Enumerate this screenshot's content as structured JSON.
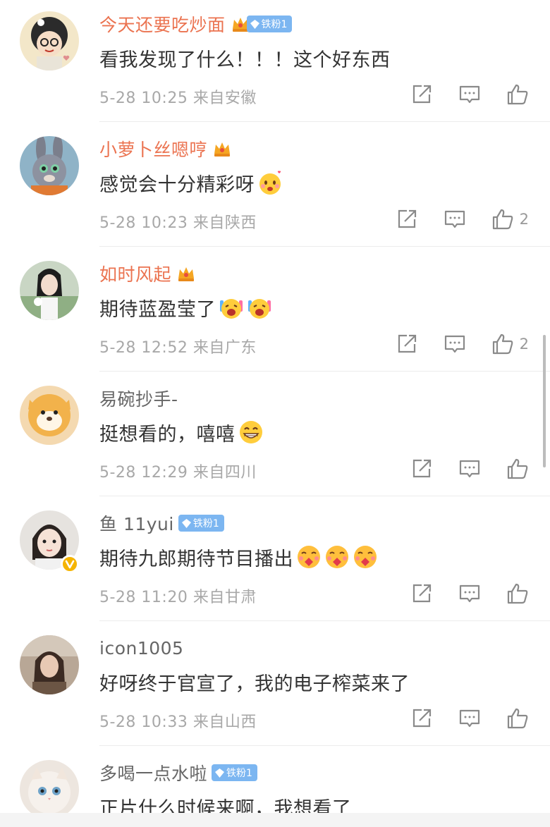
{
  "colors": {
    "vip_name": "#eb7350",
    "plain_name": "#666666",
    "text": "#333333",
    "meta": "#a8a8a8",
    "fan_badge": "#7cb6f1"
  },
  "comments": [
    {
      "name": "今天还要吃炒面",
      "vip": true,
      "crown": "crown-icon",
      "fan_badge": "铁粉1",
      "text": "看我发现了什么！！！这个好东西",
      "emoji": [],
      "time": "5-28 10:25",
      "location": "来自安徽",
      "likes": ""
    },
    {
      "name": "小萝卜丝嗯哼",
      "vip": true,
      "crown": "crown-icon",
      "fan_badge": "",
      "text": "感觉会十分精彩呀",
      "emoji": [
        "love-face-emoji"
      ],
      "time": "5-28 10:23",
      "location": "来自陕西",
      "likes": "2"
    },
    {
      "name": "如时风起",
      "vip": true,
      "crown": "crown-icon",
      "fan_badge": "",
      "text": "期待蓝盈莹了",
      "emoji": [
        "excited-face-emoji",
        "excited-face-emoji"
      ],
      "time": "5-28 12:52",
      "location": "来自广东",
      "likes": "2"
    },
    {
      "name": "易碗抄手-",
      "vip": false,
      "crown": "",
      "fan_badge": "",
      "text": "挺想看的，嘻嘻",
      "emoji": [
        "grin-emoji"
      ],
      "time": "5-28 12:29",
      "location": "来自四川",
      "likes": ""
    },
    {
      "name": "鱼 11yui",
      "vip": false,
      "crown": "",
      "fan_badge": "铁粉1",
      "text": "期待九郎期待节目播出",
      "emoji": [
        "kiss-face-emoji",
        "kiss-face-emoji",
        "kiss-face-emoji"
      ],
      "time": "5-28 11:20",
      "location": "来自甘肃",
      "likes": ""
    },
    {
      "name": "icon1005",
      "vip": false,
      "crown": "",
      "fan_badge": "",
      "text": "好呀终于官宣了，我的电子榨菜来了",
      "emoji": [],
      "time": "5-28 10:33",
      "location": "来自山西",
      "likes": ""
    },
    {
      "name": "多喝一点水啦",
      "vip": false,
      "crown": "",
      "fan_badge": "铁粉1",
      "text": "正片什么时候来啊，我想看了",
      "emoji": [],
      "time": "",
      "location": "",
      "likes": ""
    }
  ],
  "icons": {
    "share": "share-icon",
    "comment": "comment-icon",
    "like": "like-icon"
  }
}
